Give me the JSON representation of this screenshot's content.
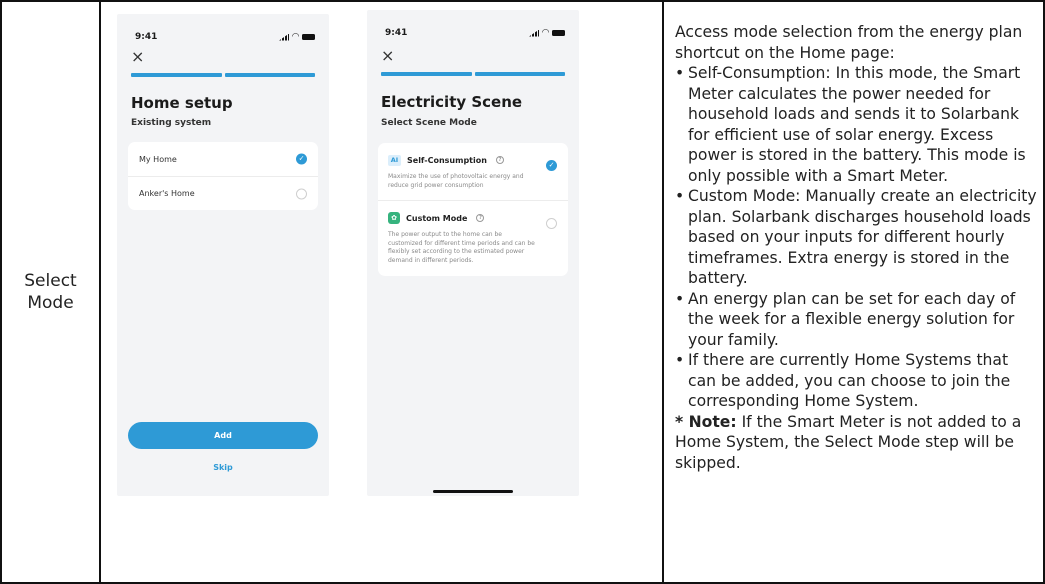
{
  "row_label": {
    "line1": "Select",
    "line2": "Mode"
  },
  "screen1": {
    "status_time": "9:41",
    "close_glyph": "×",
    "title": "Home setup",
    "subtitle": "Existing system",
    "items": [
      {
        "label": "My Home",
        "selected": true
      },
      {
        "label": "Anker's Home",
        "selected": false
      }
    ],
    "add_label": "Add",
    "skip_label": "Skip"
  },
  "screen2": {
    "status_time": "9:41",
    "close_glyph": "×",
    "title": "Electricity Scene",
    "subtitle": "Select Scene Mode",
    "modes": [
      {
        "badge": "AI",
        "name": "Self-Consumption",
        "help": "?",
        "desc": "Maximize the use of photovoltaic energy and reduce grid power consumption",
        "selected": true
      },
      {
        "badge": "✿",
        "name": "Custom Mode",
        "help": "?",
        "desc": "The power output to the home can be customized for different time periods and can be flexibly set according to the estimated power demand in different periods.",
        "selected": false
      }
    ]
  },
  "description": {
    "intro": "Access mode selection from the energy plan shortcut on the Home page:",
    "bullets": [
      "Self-Consumption: In this mode, the Smart Meter calculates the power needed for household loads and sends it to Solarbank for efficient use of solar energy. Excess power is stored in the battery. This mode is only possible with a Smart Meter.",
      "Custom Mode: Manually create an electricity plan. Solarbank discharges household loads based on your inputs for different hourly timeframes. Extra energy is stored in the battery.",
      "An energy plan can be set for each day of the week for a flexible energy solution for your family.",
      "If there are currently Home Systems that can be added, you can choose to join the corresponding Home System."
    ],
    "note_label": "* Note:",
    "note_text": " If the Smart Meter is not added to a Home System, the Select Mode step will be skipped."
  },
  "colors": {
    "accent": "#2e9ad6",
    "screen_bg": "#f3f4f6",
    "border": "#111111"
  },
  "icons": {
    "check": "check-icon",
    "close": "close-icon",
    "help": "help-circle-icon"
  }
}
